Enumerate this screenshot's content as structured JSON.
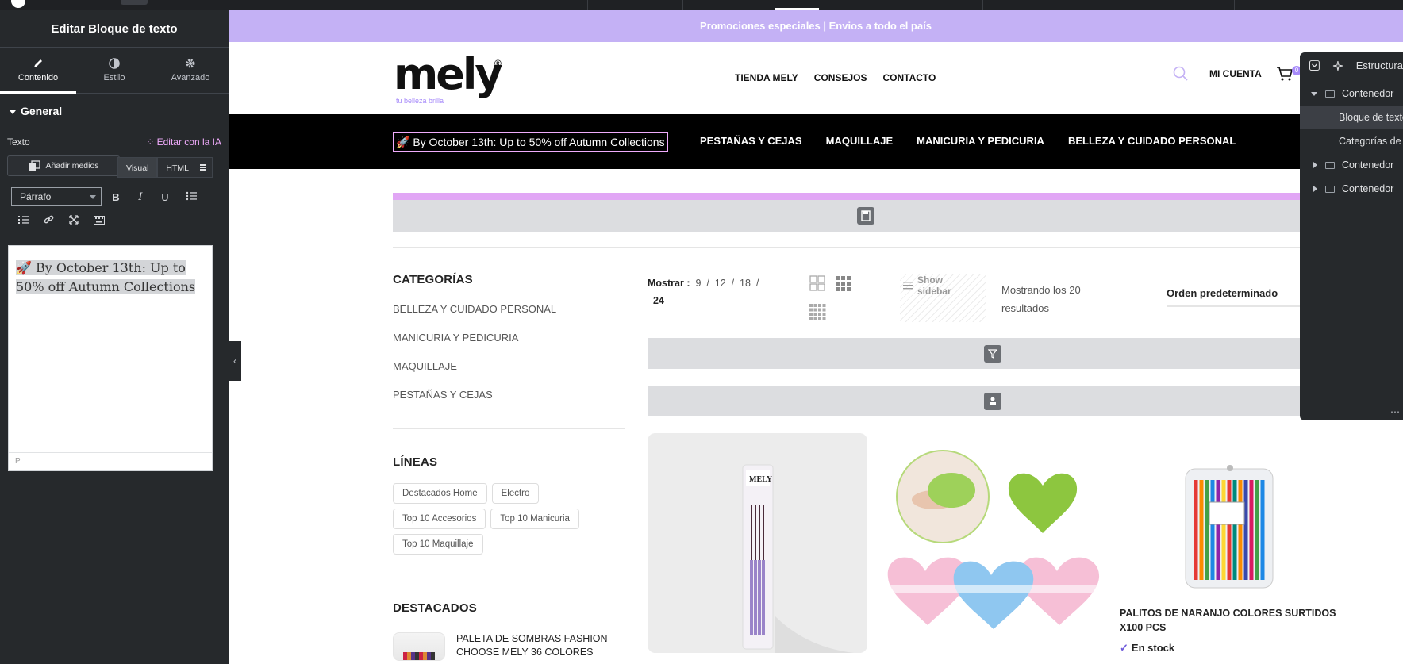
{
  "editor": {
    "title": "Editar Bloque de texto",
    "tabs": [
      {
        "label": "Contenido",
        "icon": "pencil-icon"
      },
      {
        "label": "Estilo",
        "icon": "half-circle-icon"
      },
      {
        "label": "Avanzado",
        "icon": "gear-icon"
      }
    ],
    "section": "General",
    "field_label": "Texto",
    "ai_link": "Editar con la IA",
    "media_button": "Añadir medios",
    "mode_visual": "Visual",
    "mode_html": "HTML",
    "format_select": "Párrafo",
    "content": "🚀 By October 13th: Up to 50% off Autumn Collections",
    "status_path": "P"
  },
  "site": {
    "promo_bar": "Promociones especiales | Envios a todo el país",
    "logo": {
      "word": "mely",
      "reg": "®",
      "tagline": "tu belleza brilla"
    },
    "main_nav": [
      "TIENDA MELY",
      "CONSEJOS",
      "CONTACTO"
    ],
    "account": "MI CUENTA",
    "cart_count": "0",
    "promo_text": "🚀 By October 13th: Up to 50% off Autumn Collections",
    "category_nav": [
      "PESTAÑAS Y CEJAS",
      "MAQUILLAJE",
      "MANICURIA Y PEDICURIA",
      "BELLEZA Y CUIDADO PERSONAL"
    ]
  },
  "sidebar": {
    "categories_title": "CATEGORÍAS",
    "categories": [
      "BELLEZA Y CUIDADO PERSONAL",
      "MANICURIA Y PEDICURIA",
      "MAQUILLAJE",
      "PESTAÑAS Y CEJAS"
    ],
    "lines_title": "LÍNEAS",
    "lines": [
      "Destacados Home",
      "Electro",
      "Top 10 Accesorios",
      "Top 10 Manicuria",
      "Top 10 Maquillaje"
    ],
    "featured_title": "DESTACADOS",
    "featured_item": "PALETA DE SOMBRAS FASHION CHOOSE MELY 36 COLORES"
  },
  "shop": {
    "show_label": "Mostrar :",
    "show_options": [
      "9",
      "12",
      "18",
      "24"
    ],
    "show_sidebar": "Show sidebar",
    "result_count": "Mostrando los 20 resultados",
    "sort": "Orden predeterminado",
    "product3_name": "PALITOS DE NARANJO COLORES SURTIDOS X100 PCS",
    "product3_stock": "En stock"
  },
  "structure": {
    "title": "Estructura",
    "items": [
      {
        "label": "Contenedor",
        "level": 0,
        "expanded": true
      },
      {
        "label": "Bloque de texto",
        "level": 1,
        "selected": true
      },
      {
        "label": "Categorías de productos",
        "level": 1
      },
      {
        "label": "Contenedor",
        "level": 0,
        "expanded": false
      },
      {
        "label": "Contenedor",
        "level": 0,
        "expanded": false
      }
    ]
  },
  "colors": {
    "accent_purple": "#c4b1f5",
    "ai_pink": "#f0abfc",
    "panel_dark": "#26292c"
  }
}
